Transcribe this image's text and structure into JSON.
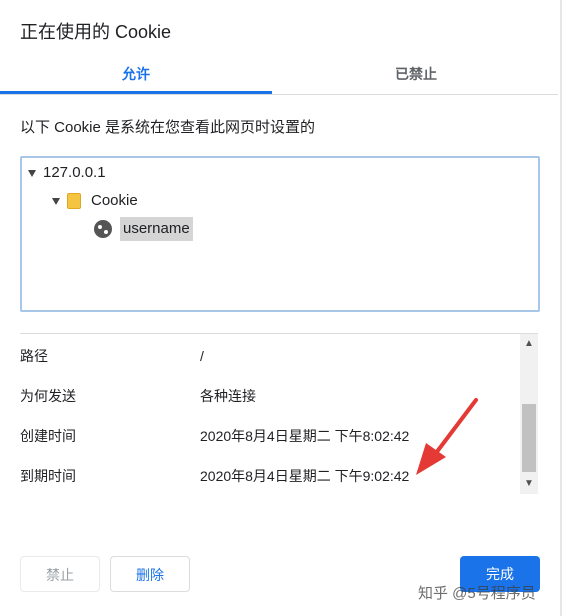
{
  "dialog": {
    "title": "正在使用的 Cookie"
  },
  "tabs": [
    {
      "label": "允许",
      "active": true
    },
    {
      "label": "已禁止",
      "active": false
    }
  ],
  "description": "以下 Cookie 是系统在您查看此网页时设置的",
  "tree": {
    "host": "127.0.0.1",
    "folder": "Cookie",
    "cookie": "username"
  },
  "details": [
    {
      "label": "路径",
      "value": "/"
    },
    {
      "label": "为何发送",
      "value": "各种连接"
    },
    {
      "label": "创建时间",
      "value": "2020年8月4日星期二 下午8:02:42"
    },
    {
      "label": "到期时间",
      "value": "2020年8月4日星期二 下午9:02:42"
    }
  ],
  "buttons": {
    "block": "禁止",
    "delete": "删除",
    "done": "完成"
  },
  "watermark": "知乎 @5号程序员",
  "colors": {
    "accent": "#1a73e8",
    "annotation_arrow": "#e53935"
  },
  "icons": {
    "expand": "triangle-down-icon",
    "folder": "folder-icon",
    "cookie": "cookie-icon",
    "scroll_up": "chevron-up-icon",
    "scroll_down": "chevron-down-icon"
  }
}
